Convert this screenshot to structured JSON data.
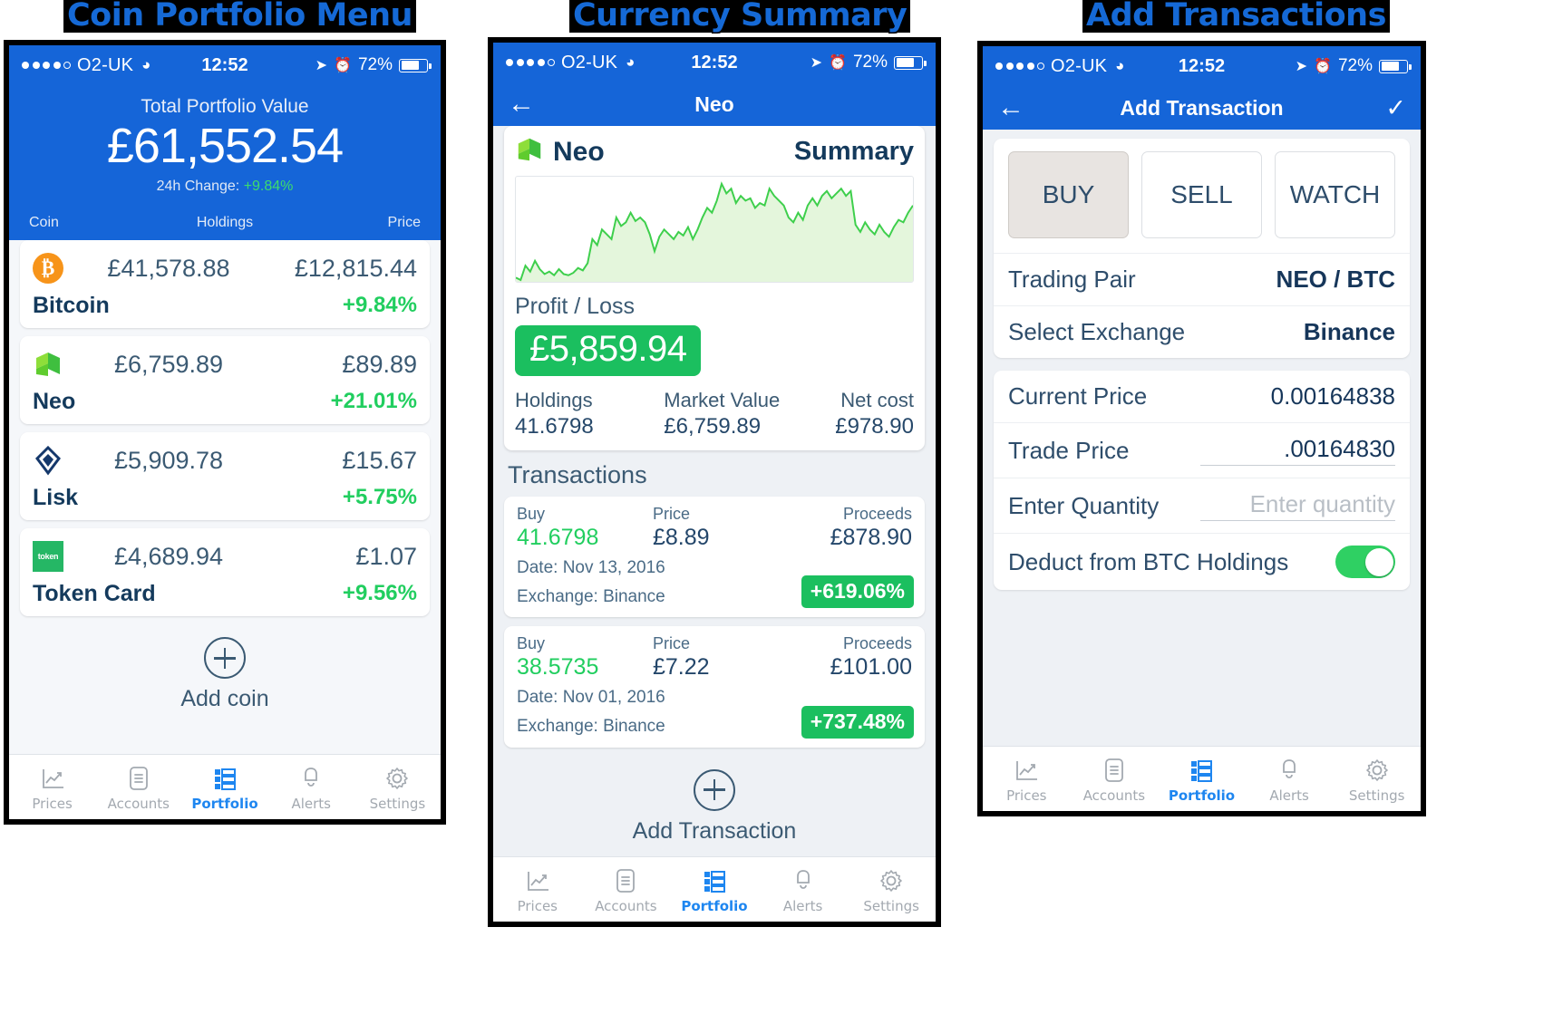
{
  "captions": {
    "panel1": "Coin Portfolio Menu",
    "panel2": "Currency Summary",
    "panel3": "Add Transactions"
  },
  "status_bar": {
    "carrier": "O2-UK",
    "time": "12:52",
    "battery_pct": "72%",
    "wifi_icon": "wifi-icon",
    "location_icon": "location-arrow-icon",
    "alarm_icon": "alarm-clock-icon"
  },
  "colors": {
    "brand_blue": "#1565d8",
    "accent_green": "#21ce5f",
    "badge_green": "#1bbf5f",
    "tab_active": "#1e86f0",
    "text_dark": "#143a5c"
  },
  "tabbar": {
    "items": [
      {
        "label": "Prices",
        "icon": "chart-line-icon",
        "active": false
      },
      {
        "label": "Accounts",
        "icon": "list-document-icon",
        "active": false
      },
      {
        "label": "Portfolio",
        "icon": "portfolio-grid-icon",
        "active": true
      },
      {
        "label": "Alerts",
        "icon": "bell-icon",
        "active": false
      },
      {
        "label": "Settings",
        "icon": "gear-icon",
        "active": false
      }
    ]
  },
  "portfolio": {
    "total_label": "Total Portfolio Value",
    "total_value": "£61,552.54",
    "change_label": "24h Change:",
    "change_value": "+9.84%",
    "columns": {
      "coin": "Coin",
      "holdings": "Holdings",
      "price": "Price"
    },
    "coins": [
      {
        "name": "Bitcoin",
        "icon": "bitcoin-icon",
        "holdings": "£41,578.88",
        "price": "£12,815.44",
        "change": "+9.84%"
      },
      {
        "name": "Neo",
        "icon": "neo-icon",
        "holdings": "£6,759.89",
        "price": "£89.89",
        "change": "+21.01%"
      },
      {
        "name": "Lisk",
        "icon": "lisk-icon",
        "holdings": "£5,909.78",
        "price": "£15.67",
        "change": "+5.75%"
      },
      {
        "name": "Token Card",
        "icon": "tokencard-icon",
        "holdings": "£4,689.94",
        "price": "£1.07",
        "change": "+9.56%"
      }
    ],
    "add_coin_label": "Add coin"
  },
  "summary": {
    "nav_title": "Neo",
    "coin_name": "Neo",
    "coin_icon": "neo-icon",
    "section_word": "Summary",
    "profit_loss_label": "Profit / Loss",
    "profit_loss_value": "£5,859.94",
    "stats": [
      {
        "key": "Holdings",
        "value": "41.6798"
      },
      {
        "key": "Market Value",
        "value": "£6,759.89"
      },
      {
        "key": "Net cost",
        "value": "£978.90"
      }
    ],
    "transactions_title": "Transactions",
    "tx_headers": {
      "type": "Buy",
      "price": "Price",
      "proceeds": "Proceeds"
    },
    "transactions": [
      {
        "type": "Buy",
        "amount": "41.6798",
        "price_label": "Price",
        "price": "£8.89",
        "proceeds_label": "Proceeds",
        "proceeds": "£878.90",
        "date": "Date: Nov 13, 2016",
        "exchange": "Exchange:  Binance",
        "pct": "+619.06%"
      },
      {
        "type": "Buy",
        "amount": "38.5735",
        "price_label": "Price",
        "price": "£7.22",
        "proceeds_label": "Proceeds",
        "proceeds": "£101.00",
        "date": "Date: Nov 01, 2016",
        "exchange": "Exchange:  Binance",
        "pct": "+737.48%"
      }
    ],
    "add_transaction_label": "Add Transaction"
  },
  "chart_data": {
    "type": "area",
    "title": "Neo price history",
    "xlabel": "",
    "ylabel": "",
    "grid": false,
    "legend": null,
    "line_color": "#3ecf4c",
    "fill_color": "#e4f6dc",
    "y": [
      12,
      10,
      22,
      17,
      26,
      19,
      15,
      17,
      14,
      19,
      15,
      14,
      16,
      20,
      18,
      24,
      44,
      39,
      52,
      48,
      44,
      62,
      55,
      58,
      66,
      59,
      62,
      58,
      48,
      34,
      46,
      52,
      48,
      44,
      50,
      47,
      54,
      44,
      52,
      62,
      70,
      66,
      76,
      90,
      82,
      86,
      74,
      80,
      76,
      78,
      70,
      74,
      72,
      86,
      80,
      76,
      72,
      62,
      58,
      66,
      60,
      72,
      78,
      72,
      80,
      84,
      78,
      82,
      86,
      80,
      84,
      56,
      50,
      58,
      52,
      48,
      56,
      50,
      46,
      54,
      60,
      58,
      66,
      72
    ]
  },
  "add_transaction": {
    "nav_title": "Add Transaction",
    "back_icon": "back-arrow-icon",
    "confirm_icon": "checkmark-icon",
    "segments": [
      {
        "label": "BUY",
        "selected": true
      },
      {
        "label": "SELL",
        "selected": false
      },
      {
        "label": "WATCH",
        "selected": false
      }
    ],
    "fields": [
      {
        "label": "Trading Pair",
        "value": "NEO / BTC",
        "style": "bold"
      },
      {
        "label": "Select  Exchange",
        "value": "Binance",
        "style": "bold"
      }
    ],
    "price_fields": [
      {
        "label": "Current Price",
        "value": "0.00164838",
        "style": "plain"
      },
      {
        "label": "Trade Price",
        "value": ".00164830",
        "style": "underline"
      },
      {
        "label": "Enter Quantity",
        "value": "",
        "placeholder": "Enter quantity",
        "style": "underline-placeholder"
      }
    ],
    "toggle_row": {
      "label": "Deduct from BTC Holdings",
      "on": true
    }
  }
}
